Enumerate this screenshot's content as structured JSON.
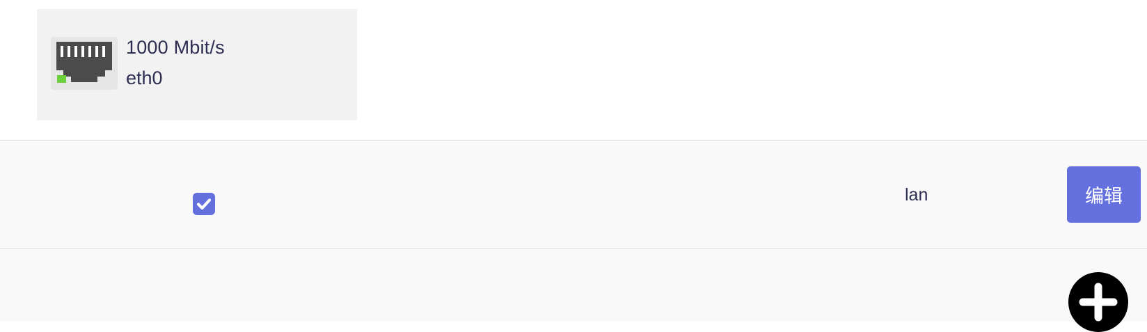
{
  "port": {
    "speed": "1000 Mbit/s",
    "name": "eth0",
    "icon": "ethernet-port-icon",
    "link_color": "#6cd13b"
  },
  "interfaces": [
    {
      "checked": true,
      "zone": "lan",
      "edit_label": "编辑"
    }
  ],
  "actions": {
    "add_icon": "plus-circle-icon"
  },
  "colors": {
    "accent": "#6470dd",
    "text": "#2d2d52",
    "card_bg": "#f2f2f2",
    "row_bg": "#f9f9f9"
  }
}
